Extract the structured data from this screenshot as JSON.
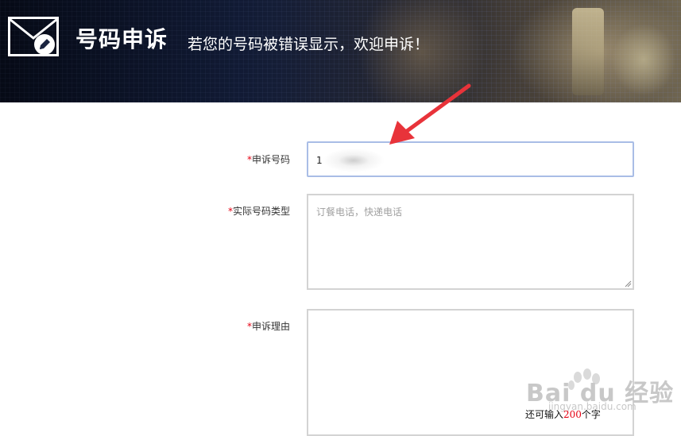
{
  "header": {
    "title": "号码申诉",
    "subtitle": "若您的号码被错误显示，欢迎申诉！",
    "icon": "envelope-edit-icon"
  },
  "form": {
    "required_mark": "*",
    "phone": {
      "label": "申诉号码",
      "value": "1"
    },
    "type": {
      "label": "实际号码类型",
      "placeholder": "订餐电话，快递电话"
    },
    "reason": {
      "label": "申诉理由",
      "counter_prefix": "还可输入",
      "counter_value": "200",
      "counter_suffix": "个字"
    }
  },
  "watermark": {
    "brand": "Bai du 经验",
    "url": "jingyan.baidu.com"
  },
  "colors": {
    "required": "#e60012",
    "focus_border": "#a9bde6",
    "arrow": "#e8333a"
  }
}
